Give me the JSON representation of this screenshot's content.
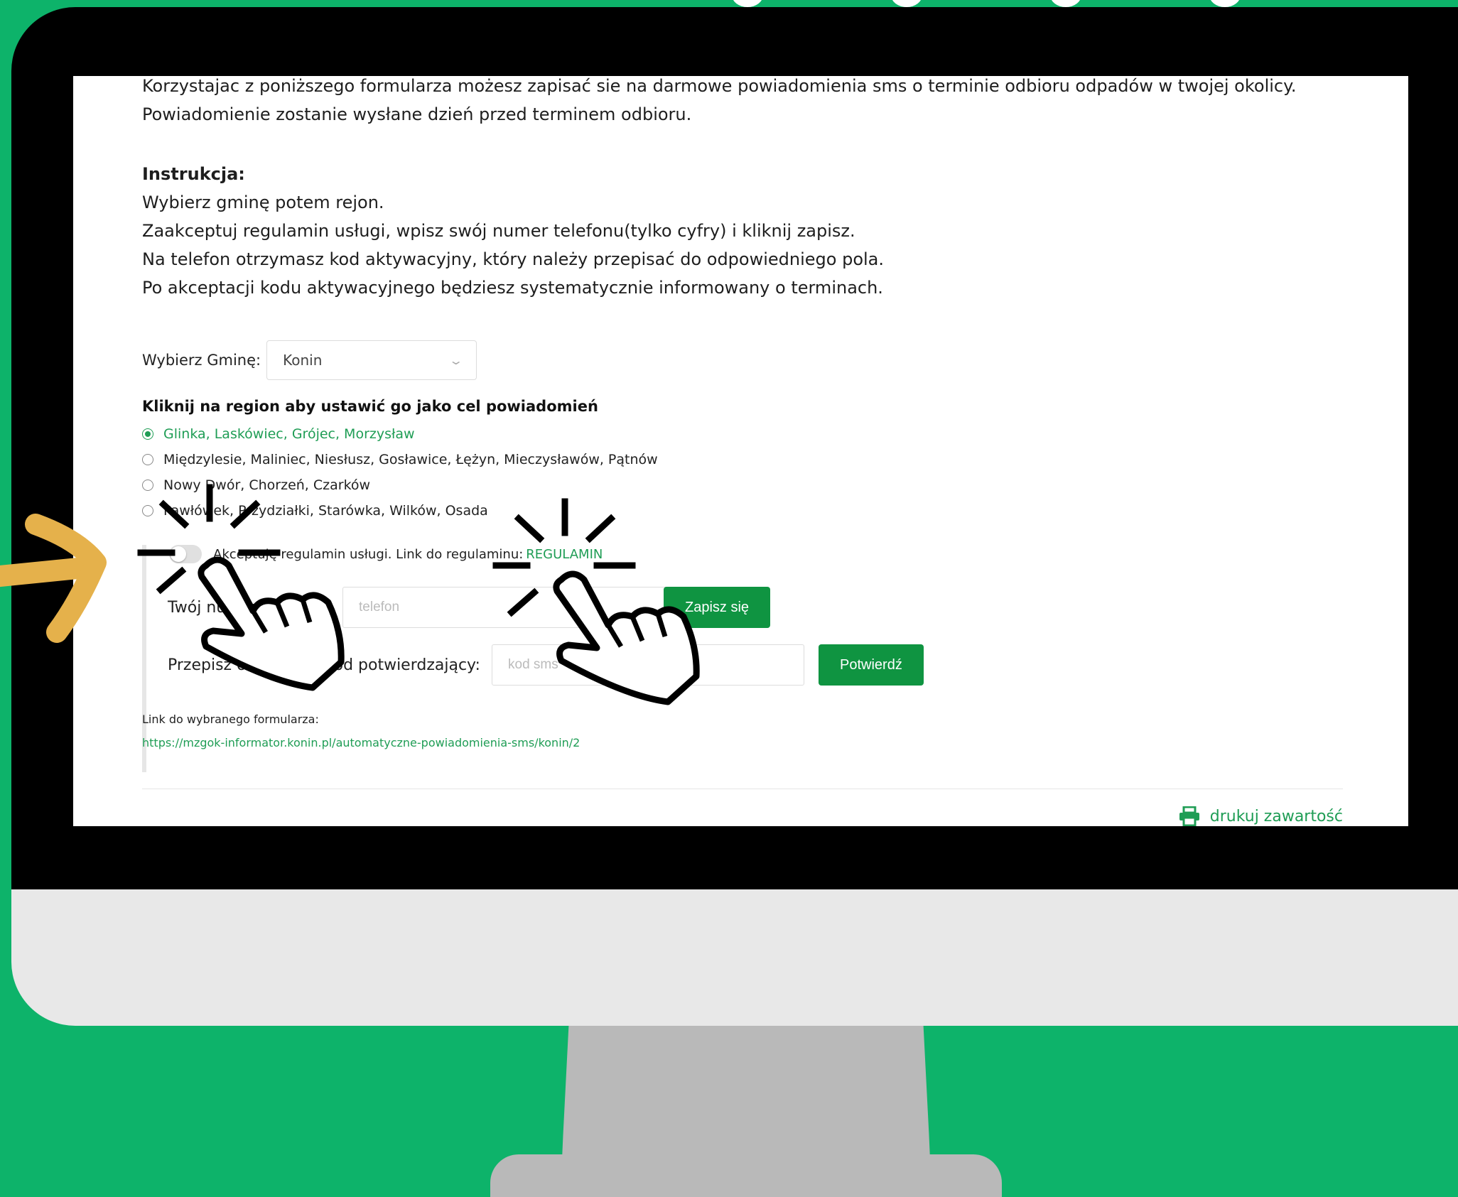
{
  "intro": {
    "line1": "Korzystajac z poniższego formularza możesz zapisać sie na darmowe powiadomienia sms o terminie odbioru odpadów w twojej okolicy.",
    "line2": "Powiadomienie zostanie wysłane dzień przed terminem odbioru."
  },
  "instructions": {
    "title": "Instrukcja:",
    "steps": [
      "Wybierz gminę potem rejon.",
      "Zaakceptuj regulamin usługi, wpisz swój numer telefonu(tylko cyfry) i kliknij zapisz.",
      "Na telefon otrzymasz kod aktywacyjny, który należy przepisać do odpowiedniego pola.",
      "Po akceptacji kodu aktywacyjnego będziesz systematycznie informowany o terminach."
    ]
  },
  "gmina": {
    "label": "Wybierz Gminę:",
    "selected": "Konin"
  },
  "regions": {
    "title": "Kliknij na region aby ustawić go jako cel powiadomień",
    "items": [
      {
        "label": "Glinka, Laskówiec, Grójec, Morzysław",
        "selected": true
      },
      {
        "label": "Międzylesie, Maliniec, Niesłusz, Gosławice, Łężyn, Mieczysławów, Pątnów",
        "selected": false
      },
      {
        "label": "Nowy Dwór, Chorzeń, Czarków",
        "selected": false
      },
      {
        "label": "Pawłówek, Przydziałki, Starówka, Wilków, Osada",
        "selected": false
      }
    ]
  },
  "form": {
    "accept_text": "Akceptuję regulamin usługi. Link do regulaminu:",
    "accept_link": "REGULAMIN",
    "phone_label": "Twój numer:",
    "phone_placeholder": "telefon",
    "submit_label": "Zapisz się",
    "code_label": "Przepisz otrzymany kod potwierdzający:",
    "code_placeholder": "kod sms",
    "confirm_label": "Potwierdź"
  },
  "link": {
    "label": "Link do wybranego formularza:",
    "url": "https://mzgok-informator.konin.pl/automatyczne-powiadomienia-sms/konin/2"
  },
  "print_label": "drukuj zawartość",
  "colors": {
    "background": "#0db36a",
    "accent": "#1f9d55",
    "button": "#0f9441",
    "arrow": "#e5b14b"
  }
}
